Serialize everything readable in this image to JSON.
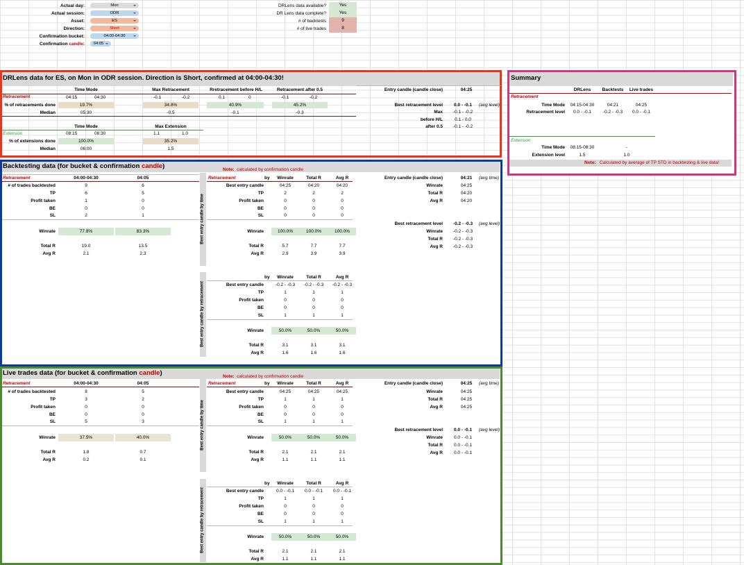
{
  "controls": {
    "actual_day": {
      "label": "Actual day:",
      "value": "Mon"
    },
    "actual_session": {
      "label": "Actual session:",
      "value": "ODR"
    },
    "asset": {
      "label": "Asset:",
      "value": "ES"
    },
    "direction": {
      "label": "Direction:",
      "value": "Short"
    },
    "confirmation_bucket": {
      "label": "Confirmation bucket:",
      "value": "04:00-04:30"
    },
    "confirmation_candle": {
      "label_a": "Confirmation ",
      "label_b": "candle",
      "label_c": ":",
      "value": "04:05"
    }
  },
  "status": {
    "drlens_available": {
      "label": "DRLens data available?",
      "value": "Yes"
    },
    "drlens_complete": {
      "label": "DR Lens data complete?",
      "value": "Yes"
    },
    "num_backtests": {
      "label": "# of backtests",
      "value": "9"
    },
    "num_live": {
      "label": "# of live trades",
      "value": "8"
    }
  },
  "colors": {
    "drlens_border": "#e8361b",
    "summary_border": "#d6337a",
    "backtest_border": "#0b3a9c",
    "live_border": "#4a8a28",
    "accent_red": "#c00000",
    "green_label": "#38a037"
  },
  "drlens": {
    "title": "DRLens data for ES, on Mon in ODR session. Direction is Short, confirmed at 04:00-04:30!",
    "ret_label": "Retracement",
    "ext_label": "Extension",
    "h_time_mode": "Time Mode",
    "h_max_ret": "Max Retracement",
    "h_ret_before": "Rretracement before H/L",
    "h_ret_after": "Retracement after 0.5",
    "tm_a": "04:15",
    "tm_b": "04:30",
    "mr_a": "-0.1",
    "mr_b": "-0.2",
    "rb_a": "0.1",
    "rb_b": "0",
    "ra_a": "-0.1",
    "ra_b": "-0.2",
    "pct_label": "% of retracements done",
    "pct_tm": "19.7%",
    "pct_mr": "34.8%",
    "pct_rb": "40.9%",
    "pct_ra": "45.2%",
    "median_label": "Median",
    "med_tm": "05:30",
    "med_mr": "-0.5",
    "med_rb": "-0.1",
    "med_ra": "-0.3",
    "ext_h_time_mode": "Time Mode",
    "ext_h_max": "Max Extension",
    "etm_a": "08:15",
    "etm_b": "08:30",
    "emx_a": "1.1",
    "emx_b": "1.0",
    "ext_pct_label": "% of extensions done",
    "ext_pct_tm": "100.0%",
    "ext_pct_mx": "35.2%",
    "ext_median_label": "Median",
    "ext_med_tm": "06:00",
    "ext_med_mx": "1.5",
    "entry_label": "Entry candle (candle close)",
    "entry_value": "04:25",
    "best_ret_label": "Best retracement level",
    "best_ret_value": "0.0 - -0.1",
    "best_ret_note": "(avg level)",
    "max_label": "Max",
    "max_value": "-0.1 - -0.2",
    "before_label": "before H/L",
    "before_value": "0.1 - 0.0",
    "after_label": "after 0.5",
    "after_value": "-0.1 - -0.2"
  },
  "summary": {
    "title": "Summary",
    "cols": [
      "DRLens",
      "Backtests",
      "Live trades"
    ],
    "ret_label": "Retracement",
    "time_mode_label": "Time Mode",
    "time_mode": [
      "04:15-04:30",
      "04:21",
      "04:25"
    ],
    "ret_level_label": "Retracement level",
    "ret_level": [
      "0.0 - -0.1",
      "-0.2 - -0.3",
      "0.0 - -0.1"
    ],
    "ext_label": "Extension",
    "ext_time_label": "Time Mode",
    "ext_time": [
      "08:15-08:30",
      "-"
    ],
    "ext_level_label": "Extension level",
    "ext_level": [
      "1.5",
      "1.0"
    ],
    "note_label": "Note:",
    "note": "Calculated by average of TP STD in backtesting & live data!"
  },
  "backtest": {
    "title_a": "Backtesting data (for bucket & confirmation ",
    "title_b": "candle",
    ")": ")",
    "title_c": ")",
    "note_label": "Note:",
    "note": "calculated by confirmation candle",
    "ret_label": "Retracement",
    "col_bucket": "04:00-04:30",
    "col_candle": "04:05",
    "rows": [
      {
        "label": "# of trades backtested",
        "a": "9",
        "b": "6"
      },
      {
        "label": "TP",
        "a": "6",
        "b": "5"
      },
      {
        "label": "Profit taken",
        "a": "1",
        "b": "0"
      },
      {
        "label": "BE",
        "a": "0",
        "b": "0"
      },
      {
        "label": "SL",
        "a": "2",
        "b": "1"
      }
    ],
    "winrate_label": "Winrate",
    "winrate_a": "77.8%",
    "winrate_b": "83.3%",
    "totalr_label": "Total R",
    "totalr_a": "19.0",
    "totalr_b": "13.5",
    "avgr_label": "Avg R",
    "avgr_a": "2.1",
    "avgr_b": "2.3",
    "time_vlabel": "Best entry candle by time",
    "ret_vlabel": "Best entry candle by retracement",
    "bytime": {
      "by": "by",
      "h1": "Winrate",
      "h2": "Total R",
      "h3": "Avg R",
      "rows": [
        {
          "label": "Best entry candle",
          "a": "04:25",
          "b": "04:20",
          "c": "04:20"
        },
        {
          "label": "TP",
          "a": "2",
          "b": "2",
          "c": "2"
        },
        {
          "label": "Profit taken",
          "a": "0",
          "b": "0",
          "c": "0"
        },
        {
          "label": "BE",
          "a": "0",
          "b": "0",
          "c": "0"
        },
        {
          "label": "SL",
          "a": "0",
          "b": "0",
          "c": "0"
        }
      ],
      "winrate_label": "Winrate",
      "w": [
        "100.0%",
        "100.0%",
        "100.0%"
      ],
      "totalr_label": "Total R",
      "tr": [
        "5.7",
        "7.7",
        "7.7"
      ],
      "avgr_label": "Avg R",
      "ar": [
        "2.9",
        "3.9",
        "3.9"
      ]
    },
    "byret": {
      "by": "by",
      "h1": "Winrate",
      "h2": "Total R",
      "h3": "Avg R",
      "rows": [
        {
          "label": "Best entry candle",
          "a": "-0.2 - -0.3",
          "b": "-0.2 - -0.3",
          "c": "-0.2 - -0.3"
        },
        {
          "label": "TP",
          "a": "1",
          "b": "1",
          "c": "1"
        },
        {
          "label": "Profit taken",
          "a": "0",
          "b": "0",
          "c": "0"
        },
        {
          "label": "BE",
          "a": "0",
          "b": "0",
          "c": "0"
        },
        {
          "label": "SL",
          "a": "1",
          "b": "1",
          "c": "1"
        }
      ],
      "winrate_label": "Winrate",
      "w": [
        "50.0%",
        "50.0%",
        "50.0%"
      ],
      "totalr_label": "Total R",
      "tr": [
        "3.1",
        "3.1",
        "3.1"
      ],
      "avgr_label": "Avg R",
      "ar": [
        "1.6",
        "1.6",
        "1.6"
      ]
    },
    "side": {
      "entry_label": "Entry candle (candle close)",
      "entry_value": "04:21",
      "entry_note": "(avg time)",
      "w_label": "Winrate",
      "w_value": "04:25",
      "tr_label": "Total R",
      "tr_value": "04:20",
      "ar_label": "Avg R",
      "ar_value": "04:20",
      "best_label": "Best retracement level",
      "best_value": "-0.2 - -0.3",
      "best_note": "(avg level)",
      "w2_value": "-0.2 - -0.3",
      "tr2_value": "-0.2 - -0.3",
      "ar2_value": "-0.2 - -0.3"
    }
  },
  "live": {
    "title_a": "Live trades data (for bucket & confirmation ",
    "title_b": "candle",
    "title_c": ")",
    "note_label": "Note:",
    "note": "calculated by confirmation candle",
    "ret_label": "Retracement",
    "col_bucket": "04:00-04:30",
    "col_candle": "04:05",
    "rows": [
      {
        "label": "# of trades backtested",
        "a": "8",
        "b": "5"
      },
      {
        "label": "TP",
        "a": "3",
        "b": "2"
      },
      {
        "label": "Profit taken",
        "a": "0",
        "b": "0"
      },
      {
        "label": "BE",
        "a": "0",
        "b": "0"
      },
      {
        "label": "SL",
        "a": "5",
        "b": "3"
      }
    ],
    "winrate_label": "Winrate",
    "winrate_a": "37.5%",
    "winrate_b": "40.0%",
    "totalr_label": "Total R",
    "totalr_a": "1.8",
    "totalr_b": "0.7",
    "avgr_label": "Avg R",
    "avgr_a": "0.2",
    "avgr_b": "0.1",
    "time_vlabel": "Best entry candle by time",
    "ret_vlabel": "Best entry candle by retracement",
    "bytime": {
      "by": "by",
      "h1": "Winrate",
      "h2": "Total R",
      "h3": "Avg R",
      "rows": [
        {
          "label": "Best entry candle",
          "a": "04:25",
          "b": "04:25",
          "c": "04:25"
        },
        {
          "label": "TP",
          "a": "1",
          "b": "1",
          "c": "1"
        },
        {
          "label": "Profit taken",
          "a": "0",
          "b": "0",
          "c": "0"
        },
        {
          "label": "BE",
          "a": "0",
          "b": "0",
          "c": "0"
        },
        {
          "label": "SL",
          "a": "1",
          "b": "1",
          "c": "1"
        }
      ],
      "winrate_label": "Winrate",
      "w": [
        "50.0%",
        "50.0%",
        "50.0%"
      ],
      "totalr_label": "Total R",
      "tr": [
        "2.1",
        "2.1",
        "2.1"
      ],
      "avgr_label": "Avg R",
      "ar": [
        "1.1",
        "1.1",
        "1.1"
      ]
    },
    "byret": {
      "by": "by",
      "h1": "Winrate",
      "h2": "Total R",
      "h3": "Avg R",
      "rows": [
        {
          "label": "Best entry candle",
          "a": "0.0 - -0.1",
          "b": "0.0 - -0.1",
          "c": "0.0 - -0.1"
        },
        {
          "label": "TP",
          "a": "1",
          "b": "1",
          "c": "1"
        },
        {
          "label": "Profit taken",
          "a": "0",
          "b": "0",
          "c": "0"
        },
        {
          "label": "BE",
          "a": "0",
          "b": "0",
          "c": "0"
        },
        {
          "label": "SL",
          "a": "1",
          "b": "1",
          "c": "1"
        }
      ],
      "winrate_label": "Winrate",
      "w": [
        "50.0%",
        "50.0%",
        "50.0%"
      ],
      "totalr_label": "Total R",
      "tr": [
        "2.1",
        "2.1",
        "2.1"
      ],
      "avgr_label": "Avg R",
      "ar": [
        "1.1",
        "1.1",
        "1.1"
      ]
    },
    "side": {
      "entry_label": "Entry candle (candle close)",
      "entry_value": "04:25",
      "entry_note": "(avg time)",
      "w_label": "Winrate",
      "w_value": "04:25",
      "tr_label": "Total R",
      "tr_value": "04:25",
      "ar_label": "Avg R",
      "ar_value": "04:25",
      "best_label": "Best retracement level",
      "best_value": "0.0 - -0.1",
      "best_note": "(avg level)",
      "w2_value": "0.0 - -0.1",
      "tr2_value": "0.0 - -0.1",
      "ar2_value": "0.0 - -0.1"
    }
  }
}
